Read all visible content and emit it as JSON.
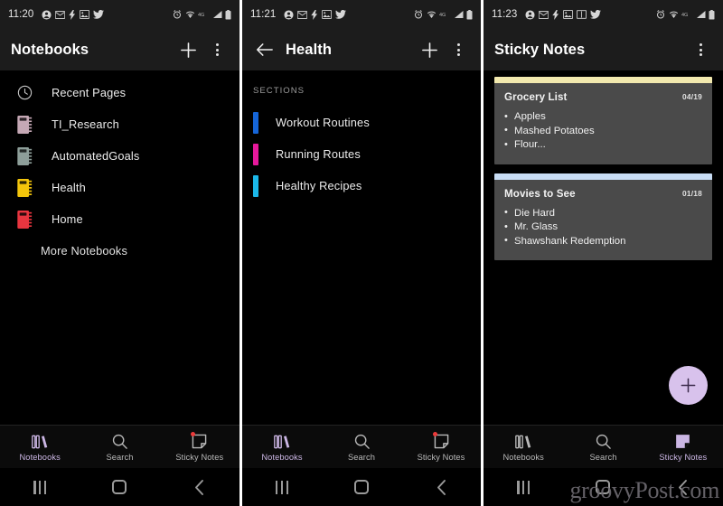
{
  "colors": {
    "accent_purple": "#cbb6e4",
    "fab": "#d8c2ec",
    "card_bg": "#4a4a4a",
    "appbar_bg": "#1c1c1c",
    "screen_bg": "#000000",
    "badge_red": "#ec3a3a"
  },
  "panels": [
    {
      "status": {
        "time": "11:20",
        "left_icons": [
          "account-icon",
          "mail-icon",
          "flash-icon",
          "photo-icon",
          "twitter-icon"
        ],
        "right_icons": [
          "alarm-icon",
          "wifi-icon",
          "network-4g-icon",
          "signal-icon",
          "battery-icon"
        ]
      },
      "appbar": {
        "title": "Notebooks",
        "has_back": false,
        "add_label": "+",
        "menu_label": "More options"
      },
      "notebooks": [
        {
          "label": "Recent Pages",
          "icon": "clock-icon",
          "color": "#c9c9c9"
        },
        {
          "label": "TI_Research",
          "icon": "notebook-icon",
          "color": "#c5a8b5"
        },
        {
          "label": "AutomatedGoals",
          "icon": "notebook-icon",
          "color": "#8d9e99"
        },
        {
          "label": "Health",
          "icon": "notebook-icon",
          "color": "#f3c50b"
        },
        {
          "label": "Home",
          "icon": "notebook-icon",
          "color": "#e8353f"
        }
      ],
      "more_notebooks": "More Notebooks",
      "tabs": [
        {
          "label": "Notebooks",
          "icon": "books-icon",
          "active": true,
          "badge": false
        },
        {
          "label": "Search",
          "icon": "search-icon",
          "active": false,
          "badge": false
        },
        {
          "label": "Sticky Notes",
          "icon": "sticky-note-icon",
          "active": false,
          "badge": true
        }
      ]
    },
    {
      "status": {
        "time": "11:21",
        "left_icons": [
          "account-icon",
          "mail-icon",
          "flash-icon",
          "photo-icon",
          "twitter-icon"
        ],
        "right_icons": [
          "alarm-icon",
          "wifi-icon",
          "network-4g-icon",
          "signal-icon",
          "battery-icon"
        ]
      },
      "appbar": {
        "title": "Health",
        "has_back": true,
        "add_label": "+",
        "menu_label": "More options"
      },
      "sections_header": "SECTIONS",
      "sections": [
        {
          "label": "Workout Routines",
          "color": "#1565d8"
        },
        {
          "label": "Running Routes",
          "color": "#e6189b"
        },
        {
          "label": "Healthy Recipes",
          "color": "#1bb7e8"
        }
      ],
      "tabs": [
        {
          "label": "Notebooks",
          "icon": "books-icon",
          "active": true,
          "badge": false
        },
        {
          "label": "Search",
          "icon": "search-icon",
          "active": false,
          "badge": false
        },
        {
          "label": "Sticky Notes",
          "icon": "sticky-note-icon",
          "active": false,
          "badge": true
        }
      ]
    },
    {
      "status": {
        "time": "11:23",
        "left_icons": [
          "account-icon",
          "mail-icon",
          "flash-icon",
          "photo-icon",
          "book-icon",
          "twitter-icon"
        ],
        "right_icons": [
          "alarm-icon",
          "wifi-icon",
          "network-4g-icon",
          "signal-icon",
          "battery-icon"
        ]
      },
      "appbar": {
        "title": "Sticky Notes",
        "has_back": false,
        "menu_label": "More options"
      },
      "notes": [
        {
          "title": "Grocery List",
          "date": "04/19",
          "stripe": "#f2e9ae",
          "items": [
            "Apples",
            "Mashed Potatoes",
            "Flour..."
          ]
        },
        {
          "title": "Movies to See",
          "date": "01/18",
          "stripe": "#c8ddf5",
          "items": [
            "Die Hard",
            "Mr. Glass",
            "Shawshank Redemption"
          ]
        }
      ],
      "fab": {
        "label": "+",
        "name": "add-note-fab"
      },
      "tabs": [
        {
          "label": "Notebooks",
          "icon": "books-icon",
          "active": false,
          "badge": false
        },
        {
          "label": "Search",
          "icon": "search-icon",
          "active": false,
          "badge": false
        },
        {
          "label": "Sticky Notes",
          "icon": "sticky-note-icon",
          "active": true,
          "badge": false
        }
      ]
    }
  ],
  "android_nav": {
    "recents_label": "Recents",
    "home_label": "Home",
    "back_label": "Back"
  },
  "watermark": "groovyPost.com"
}
